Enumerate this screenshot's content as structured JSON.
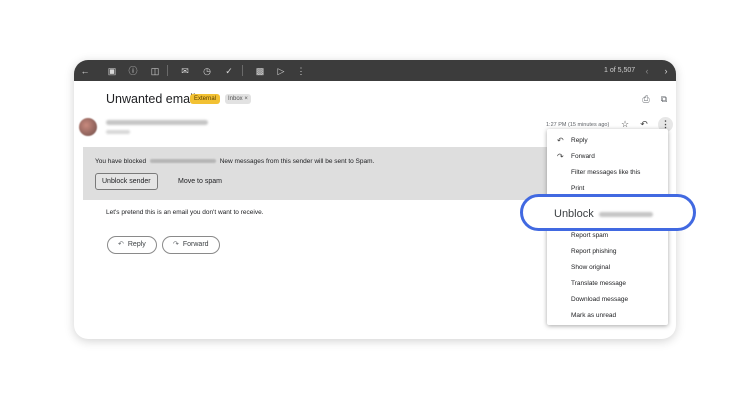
{
  "toolbar": {
    "icons": [
      "back-arrow-icon",
      "archive-icon",
      "report-spam-icon",
      "delete-icon",
      "mail-icon",
      "snooze-icon",
      "add-task-icon",
      "move-to-icon",
      "label-icon",
      "more-icon"
    ],
    "pagination": "1 of 5,507"
  },
  "email": {
    "subject": "Unwanted email",
    "labels": [
      "External",
      "Inbox ×"
    ],
    "time": "1:27 PM (15 minutes ago)"
  },
  "banner": {
    "text_before": "You have blocked",
    "text_after": "New messages from this sender will be sent to Spam.",
    "unblock_button": "Unblock sender",
    "spam_button": "Move to spam"
  },
  "body": {
    "text": "Let's pretend this is an email you don't want to receive."
  },
  "actions": {
    "reply": "Reply",
    "forward": "Forward"
  },
  "menu": {
    "items": [
      "Reply",
      "Forward",
      "Filter messages like this",
      "Print",
      "Report spam",
      "Report phishing",
      "Show original",
      "Translate message",
      "Download message",
      "Mark as unread"
    ]
  },
  "callout": {
    "text": "Unblock"
  },
  "colors": {
    "toolbar": "#3c3c3c",
    "external_label": "#f2c133",
    "callout_border": "#4169e1",
    "banner": "#dedede"
  }
}
